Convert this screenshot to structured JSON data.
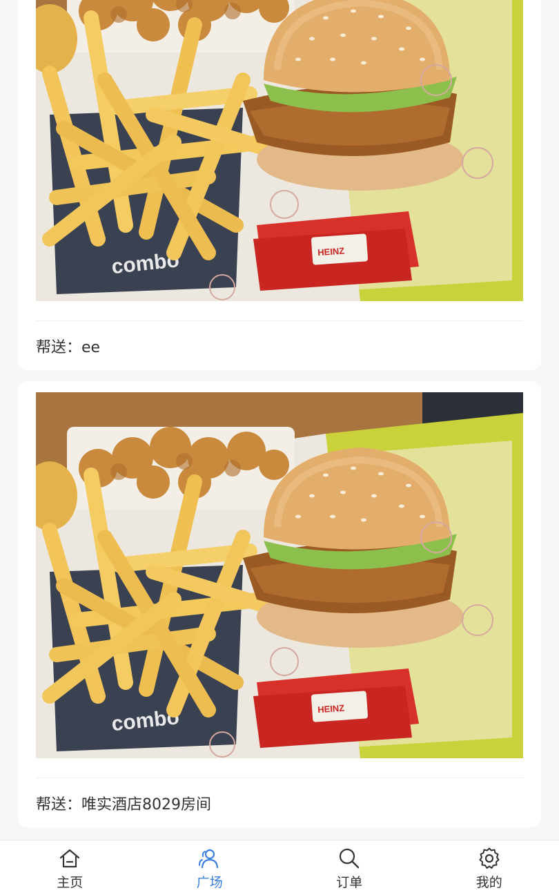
{
  "feed": {
    "posts": [
      {
        "deliver_label": "帮送：",
        "deliver_value": "ee"
      },
      {
        "deliver_label": "帮送：",
        "deliver_value": "唯实酒店8029房间"
      }
    ],
    "photo_box_text": "combo",
    "photo_sauce_text": "HEINZ"
  },
  "tabbar": {
    "active_color": "#3b7fe0",
    "items": [
      {
        "label": "主页",
        "icon": "home-icon",
        "active": false
      },
      {
        "label": "广场",
        "icon": "users-icon",
        "active": true
      },
      {
        "label": "订单",
        "icon": "search-icon",
        "active": false
      },
      {
        "label": "我的",
        "icon": "gear-icon",
        "active": false
      }
    ]
  }
}
